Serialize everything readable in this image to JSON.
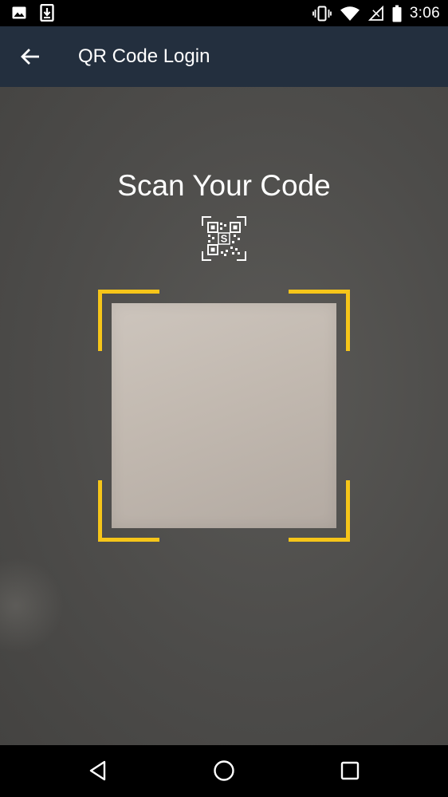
{
  "status_bar": {
    "time": "3:06",
    "left_icons": [
      "image-icon",
      "download-icon"
    ],
    "right_icons": [
      "vibrate-icon",
      "wifi-icon",
      "no-signal-icon",
      "battery-icon"
    ]
  },
  "app_bar": {
    "title": "QR Code Login",
    "back_icon": "arrow-back-icon"
  },
  "scanner": {
    "title": "Scan Your Code",
    "qr_icon": "qr-code-icon",
    "qr_badge_letter": "S",
    "frame_color": "#f6c519"
  },
  "nav_bar": {
    "icons": [
      "nav-back-icon",
      "nav-home-icon",
      "nav-recents-icon"
    ]
  },
  "colors": {
    "app_bar": "#232f3e",
    "accent_frame": "#f6c519",
    "camera_bg": "#4c4b49"
  }
}
